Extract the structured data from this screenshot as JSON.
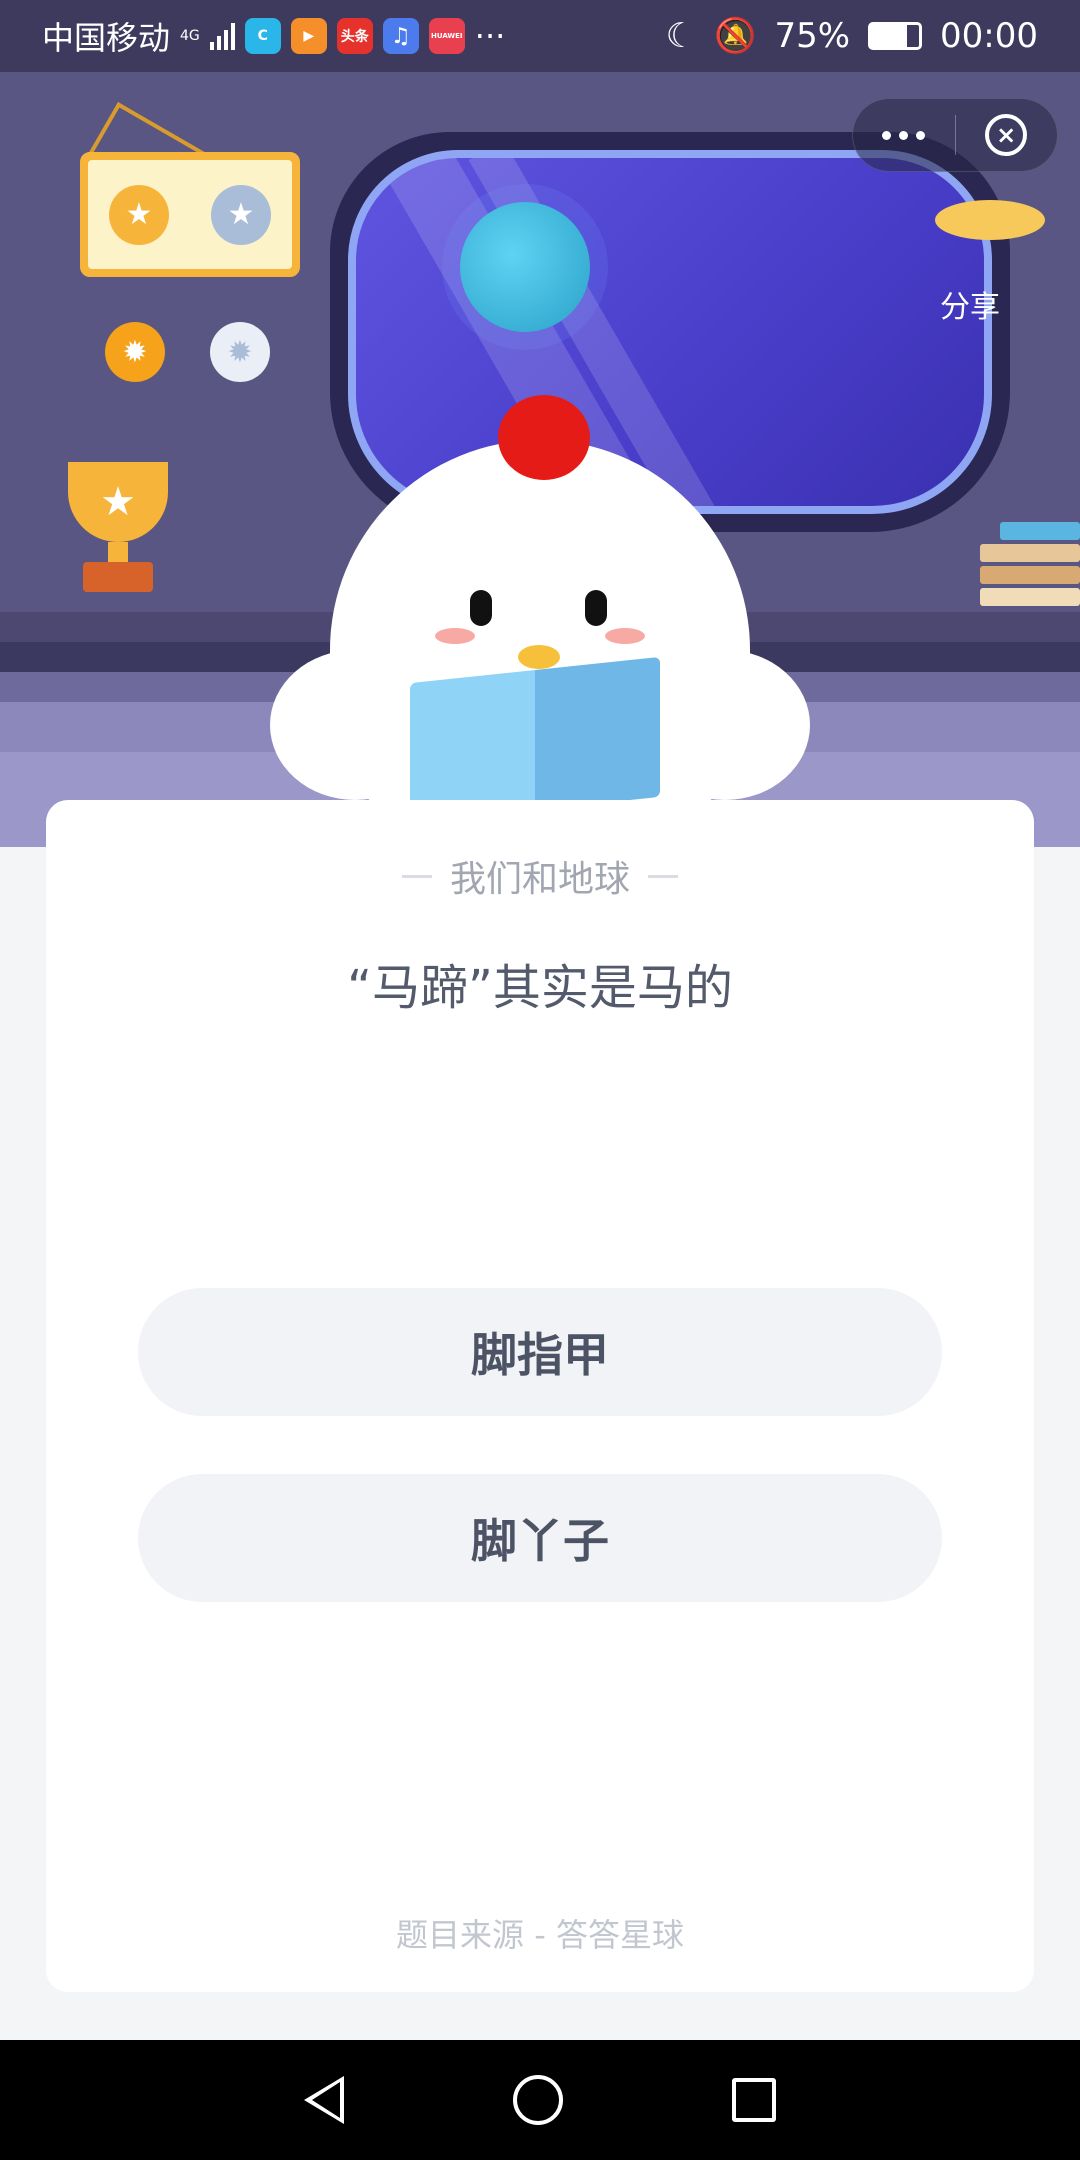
{
  "status_bar": {
    "carrier": "中国移动",
    "network": "4G",
    "more": "···",
    "battery": "75%",
    "time": "00:00",
    "apps": [
      {
        "icon": "c-app-icon",
        "label": "C",
        "color": "#2ab6e8"
      },
      {
        "icon": "video-app-icon",
        "label": "▶",
        "color": "#f58f2a"
      },
      {
        "icon": "toutiao-app-icon",
        "label": "头条",
        "color": "#e5322d"
      },
      {
        "icon": "music-app-icon",
        "label": "♫",
        "color": "#4b7bec"
      },
      {
        "icon": "huawei-store-icon",
        "label": "HUAWEI",
        "color": "#e8404f"
      }
    ]
  },
  "hero": {
    "share_label": "分享"
  },
  "capsule": {
    "close_symbol": "×"
  },
  "quiz": {
    "subject": "我们和地球",
    "question": "“马蹄”其实是马的",
    "options": [
      "脚指甲",
      "脚丫子"
    ],
    "source": "题目来源 - 答答星球"
  },
  "colors": {
    "hero_bg": "#5a5683",
    "card_bg": "#ffffff",
    "option_bg": "#f2f3f6",
    "question_text": "#535a6b"
  }
}
